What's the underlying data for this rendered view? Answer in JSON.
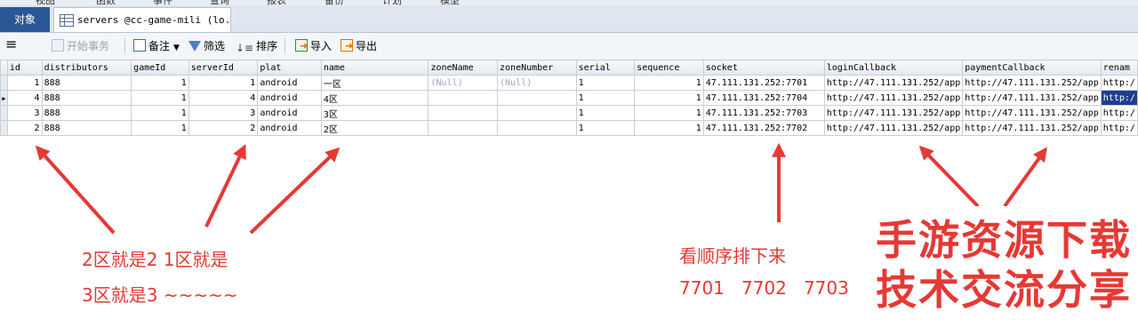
{
  "menu": [
    "视图",
    "函数",
    "事件",
    "查询",
    "报表",
    "备份",
    "计划",
    "模型"
  ],
  "tabs": {
    "objects": "对象",
    "servers": "servers @cc-game-mili (lo..."
  },
  "toolbar": {
    "hamburger": "≡",
    "begin_transaction": "开始事务",
    "note": "备注",
    "filter": "筛选",
    "sort": "排序",
    "import": "导入",
    "export": "导出"
  },
  "table": {
    "columns": [
      "id",
      "distributors",
      "gameId",
      "serverId",
      "plat",
      "name",
      "zoneName",
      "zoneNumber",
      "serial",
      "sequence",
      "socket",
      "loginCallback",
      "paymentCallback",
      "renam"
    ],
    "rows": [
      [
        "1",
        "888",
        "1",
        "1",
        "android",
        "一区",
        "(Null)",
        "(Null)",
        "1",
        "1",
        "47.111.131.252:7701",
        "http://47.111.131.252/app",
        "http://47.111.131.252/app",
        "http:/"
      ],
      [
        "4",
        "888",
        "1",
        "4",
        "android",
        "4区",
        "",
        "",
        "1",
        "1",
        "47.111.131.252:7704",
        "http://47.111.131.252/app",
        "http://47.111.131.252/app",
        "http:/"
      ],
      [
        "3",
        "888",
        "1",
        "3",
        "android",
        "3区",
        "",
        "",
        "1",
        "1",
        "47.111.131.252:7703",
        "http://47.111.131.252/app",
        "http://47.111.131.252/app",
        "http:/"
      ],
      [
        "2",
        "888",
        "1",
        "2",
        "android",
        "2区",
        "",
        "",
        "1",
        "1",
        "47.111.131.252:7702",
        "http://47.111.131.252/app",
        "http://47.111.131.252/app",
        "http:/"
      ]
    ]
  },
  "annotations": {
    "left_line1": "2区就是2 1区就是",
    "left_line2": "3区就是3 ~~~~~",
    "right_line1": "看顺序排下来",
    "right_line2": "7701   7702   7703"
  },
  "watermark": {
    "line1": "手游资源下载",
    "line2": "技术交流分享"
  },
  "colors": {
    "accent": "#2b5797",
    "annotation": "#e53935",
    "selected_cell": "#1f3f8a",
    "null_text": "#9aa6c8"
  }
}
